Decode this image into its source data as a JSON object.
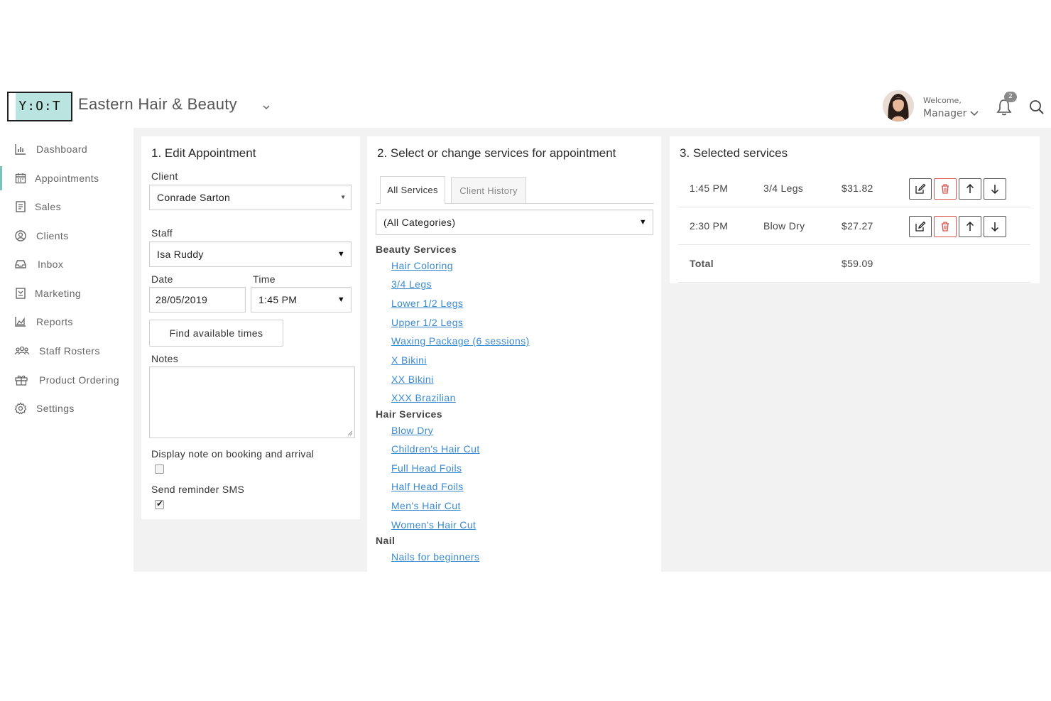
{
  "header": {
    "logo_text": "Y:O:T",
    "business_name": "Eastern Hair & Beauty",
    "welcome": "Welcome,",
    "user_role": "Manager",
    "notification_count": "2"
  },
  "sidebar": {
    "items": [
      {
        "label": "Dashboard",
        "icon": "bar-chart-icon"
      },
      {
        "label": "Appointments",
        "icon": "calendar-icon",
        "active": true
      },
      {
        "label": "Sales",
        "icon": "receipt-icon"
      },
      {
        "label": "Clients",
        "icon": "user-circle-icon"
      },
      {
        "label": "Inbox",
        "icon": "inbox-icon"
      },
      {
        "label": "Marketing",
        "icon": "newsletter-icon"
      },
      {
        "label": "Reports",
        "icon": "area-chart-icon"
      },
      {
        "label": "Staff Rosters",
        "icon": "group-icon"
      },
      {
        "label": "Product Ordering",
        "icon": "gift-icon"
      },
      {
        "label": "Settings",
        "icon": "gear-icon"
      }
    ]
  },
  "edit": {
    "title": "1. Edit Appointment",
    "client_label": "Client",
    "client_value": "Conrade Sarton",
    "staff_label": "Staff",
    "staff_value": "Isa Ruddy",
    "date_label": "Date",
    "date_value": "28/05/2019",
    "time_label": "Time",
    "time_value": "1:45 PM",
    "find_button": "Find available times",
    "notes_label": "Notes",
    "notes_value": "",
    "display_note_label": "Display note on booking and arrival",
    "display_note_checked": false,
    "sms_label": "Send reminder SMS",
    "sms_checked": true
  },
  "services": {
    "title": "2. Select or change services for appointment",
    "tabs": [
      "All Services",
      "Client History"
    ],
    "category_select": "(All Categories)",
    "groups": [
      {
        "name": "Beauty Services",
        "items": [
          "Hair Coloring",
          "3/4 Legs",
          "Lower 1/2 Legs",
          "Upper 1/2 Legs",
          "Waxing Package (6 sessions)",
          "X Bikini",
          "XX Bikini",
          "XXX Brazilian"
        ]
      },
      {
        "name": "Hair Services",
        "items": [
          "Blow Dry",
          "Children's Hair Cut",
          "Full Head Foils",
          "Half Head Foils",
          "Men's Hair Cut",
          "Women's Hair Cut"
        ]
      },
      {
        "name": "Nail",
        "items": [
          "Nails for beginners"
        ]
      }
    ]
  },
  "selected": {
    "title": "3. Selected services",
    "rows": [
      {
        "time": "1:45 PM",
        "service": "3/4 Legs",
        "price": "$31.82"
      },
      {
        "time": "2:30 PM",
        "service": "Blow Dry",
        "price": "$27.27"
      }
    ],
    "total_label": "Total",
    "total_value": "$59.09"
  },
  "colors": {
    "accent": "#7bc4bc",
    "link": "#3b8ad0",
    "danger": "#d9534f",
    "panel_bg": "#f2f2f2"
  }
}
